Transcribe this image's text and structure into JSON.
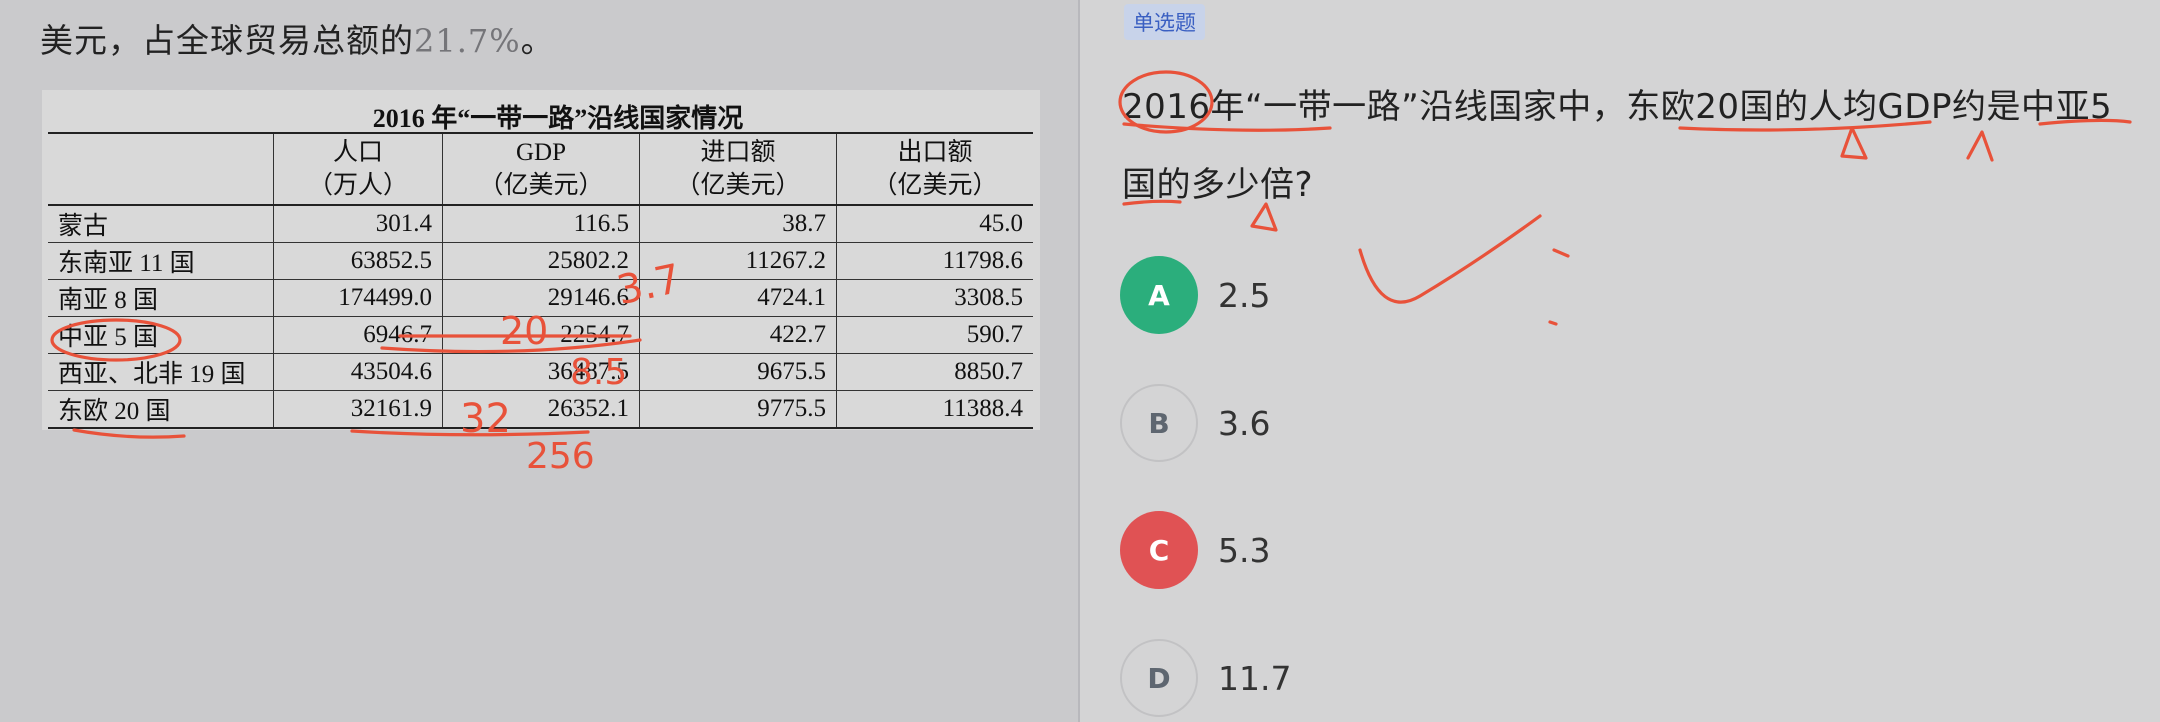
{
  "passage": {
    "intro_prefix": "美元，占全球贸易总额的",
    "intro_percent": "21.7%",
    "intro_suffix": "。"
  },
  "table": {
    "title": "2016 年“一带一路”沿线国家情况",
    "headers": [
      {
        "line1": "",
        "line2": ""
      },
      {
        "line1": "人口",
        "line2": "（万人）"
      },
      {
        "line1": "GDP",
        "line2": "（亿美元）"
      },
      {
        "line1": "进口额",
        "line2": "（亿美元）"
      },
      {
        "line1": "出口额",
        "line2": "（亿美元）"
      }
    ],
    "rows": [
      [
        "蒙古",
        "301.4",
        "116.5",
        "38.7",
        "45.0"
      ],
      [
        "东南亚 11 国",
        "63852.5",
        "25802.2",
        "11267.2",
        "11798.6"
      ],
      [
        "南亚 8 国",
        "174499.0",
        "29146.6",
        "4724.1",
        "3308.5"
      ],
      [
        "中亚 5 国",
        "6946.7",
        "2254.7",
        "422.7",
        "590.7"
      ],
      [
        "西亚、北非 19 国",
        "43504.6",
        "36487.5",
        "9675.5",
        "8850.7"
      ],
      [
        "东欧 20 国",
        "32161.9",
        "26352.1",
        "9775.5",
        "11388.4"
      ]
    ]
  },
  "question": {
    "tag": "单选题",
    "text": "2016年“一带一路”沿线国家中，东欧20国的人均GDP约是中亚5国的多少倍?"
  },
  "options": [
    {
      "letter": "A",
      "text": "2.5",
      "state": "correct"
    },
    {
      "letter": "B",
      "text": "3.6",
      "state": "plain"
    },
    {
      "letter": "C",
      "text": "5.3",
      "state": "wrong"
    },
    {
      "letter": "D",
      "text": "11.7",
      "state": "plain"
    }
  ],
  "handwriting": {
    "note_1": "3.7",
    "note_2": "20",
    "note_3": "8.5",
    "note_4": "32",
    "note_5": "256"
  },
  "colors": {
    "ink": "#e8523a",
    "correct": "#2bae7c",
    "wrong": "#e05254",
    "tag_text": "#3a5fc2"
  }
}
